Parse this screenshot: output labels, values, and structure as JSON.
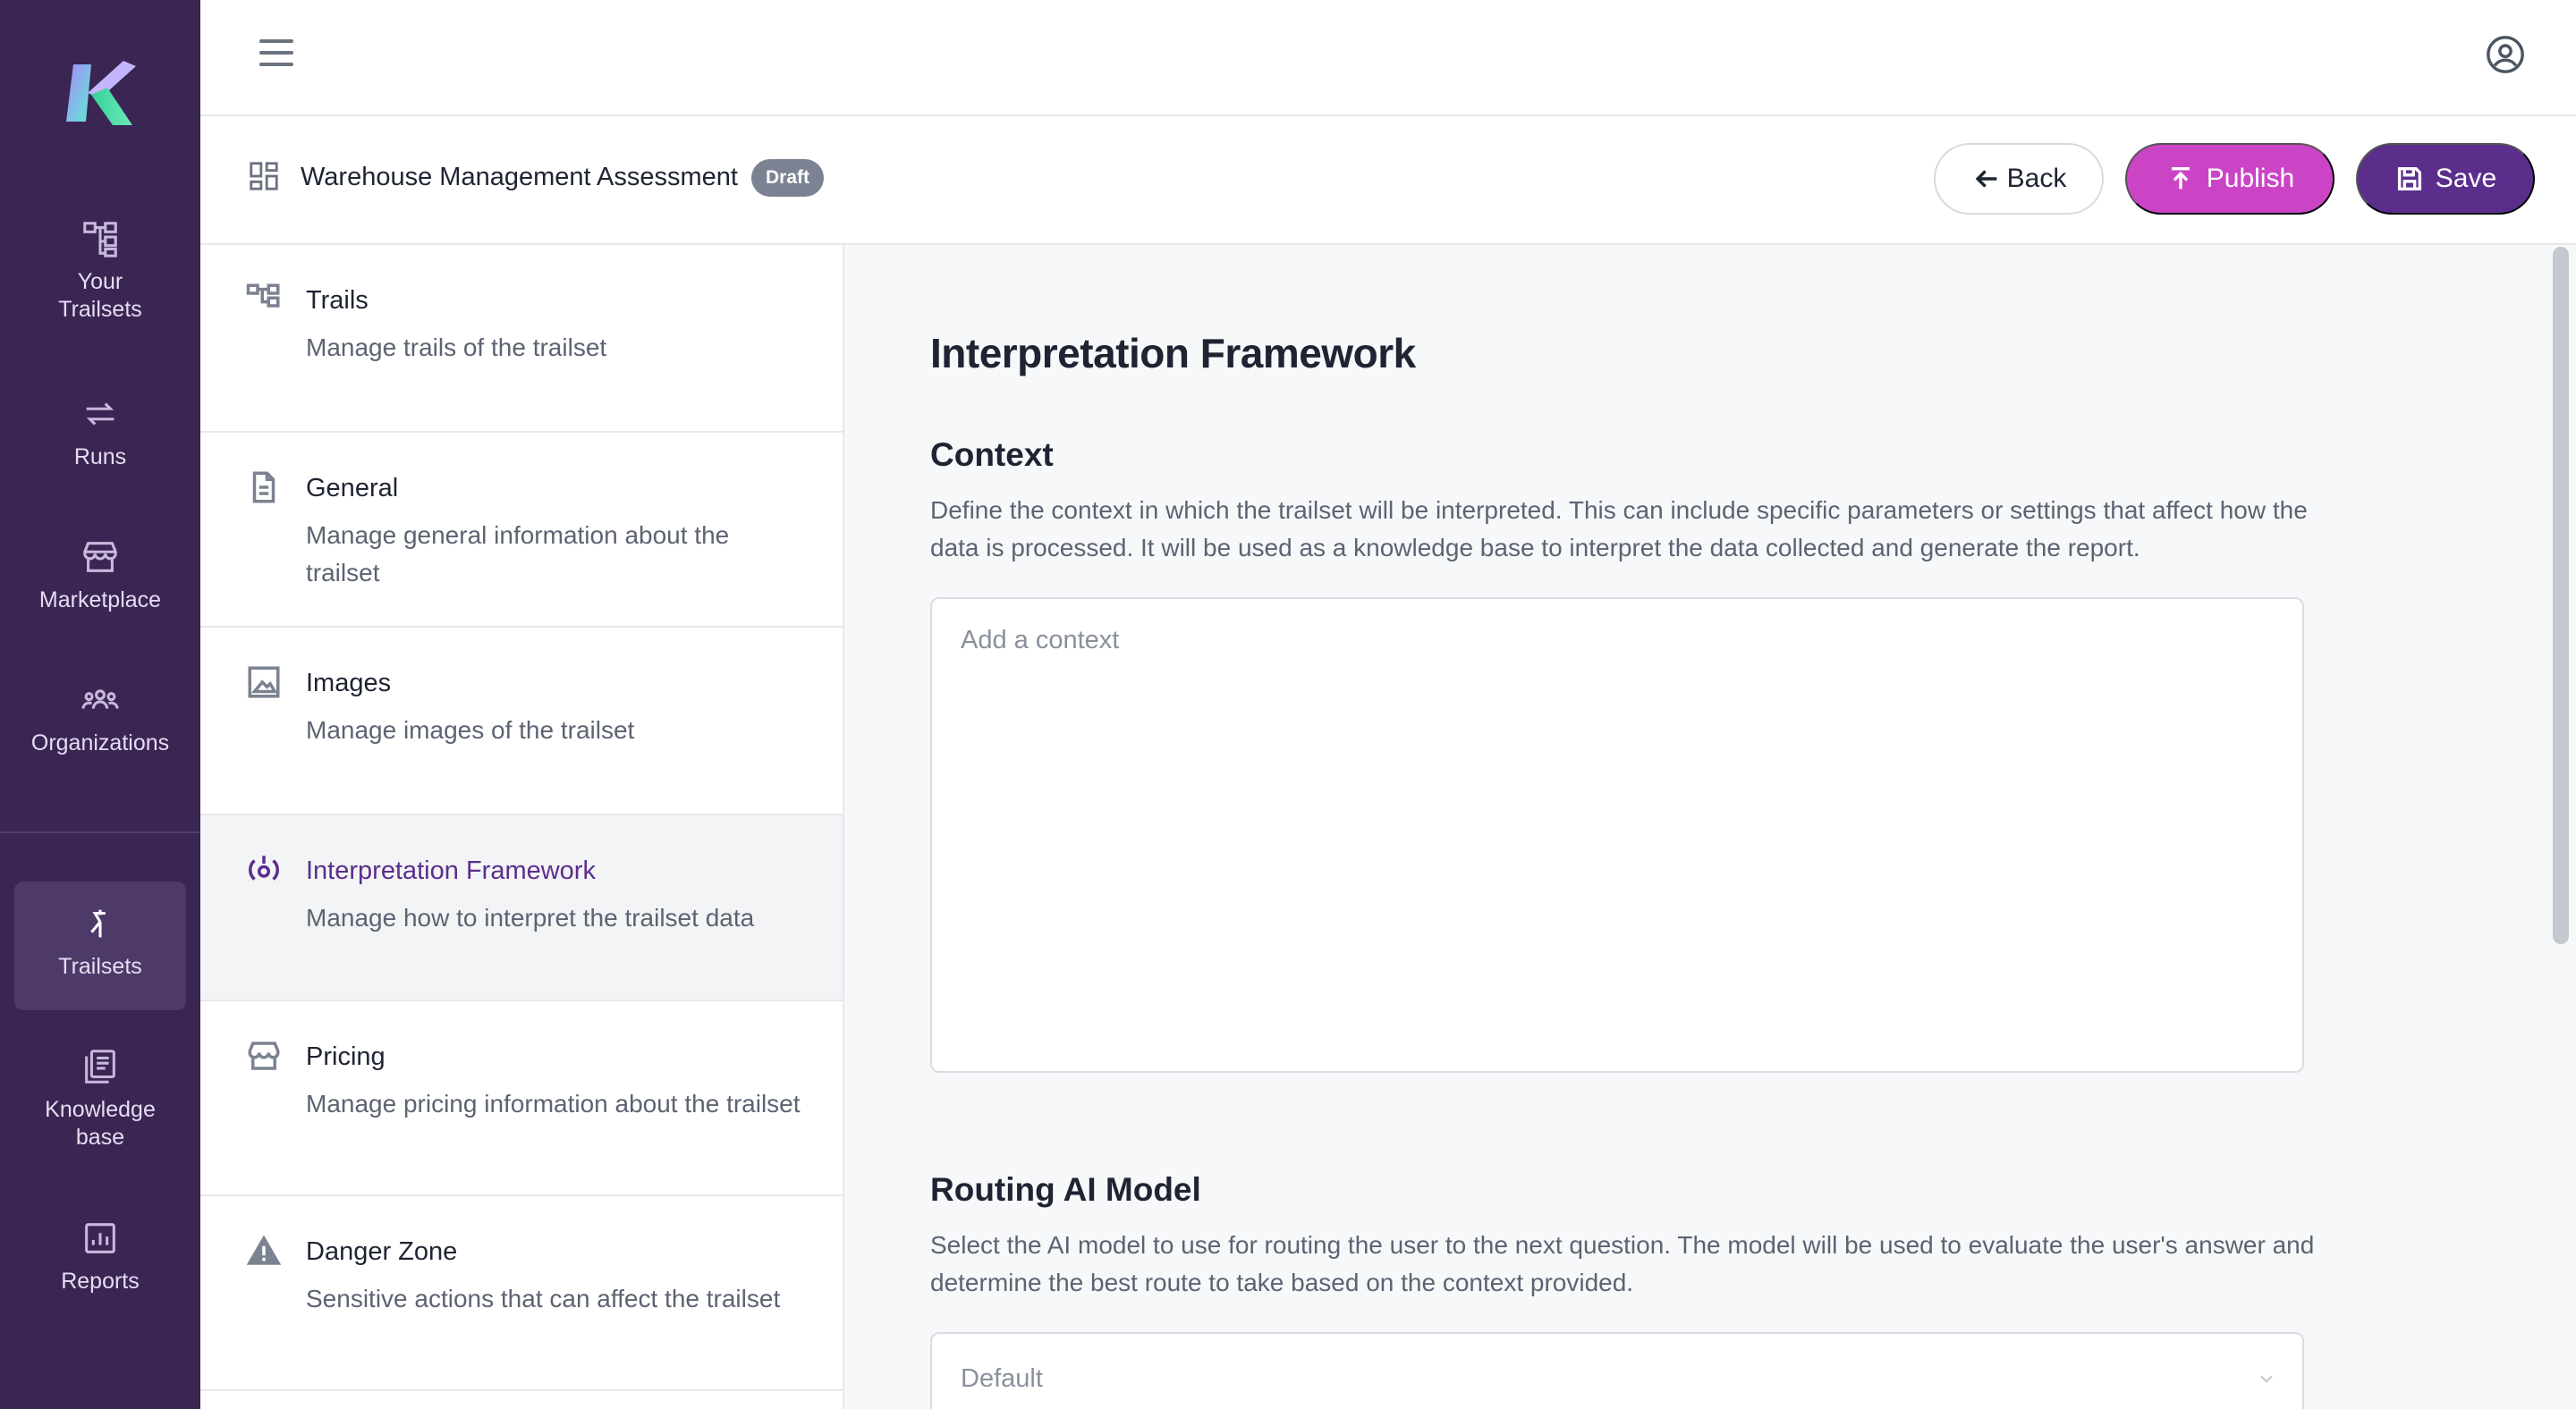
{
  "app": {
    "brand_colors": {
      "rail": "#3a2553",
      "accent": "#5b2e8c",
      "publish": "#cc44c6"
    },
    "logo_icon": "k-logo-icon"
  },
  "rail": {
    "items": [
      {
        "label": "Your\nTrailsets",
        "icon": "hierarchy-icon"
      },
      {
        "label": "Runs",
        "icon": "repeat-icon"
      },
      {
        "label": "Marketplace",
        "icon": "storefront-icon"
      },
      {
        "label": "Organizations",
        "icon": "people-icon"
      },
      {
        "label": "Trailsets",
        "icon": "merge-icon",
        "active": true
      },
      {
        "label": "Knowledge\nbase",
        "icon": "library-icon"
      },
      {
        "label": "Reports",
        "icon": "chart-icon"
      }
    ]
  },
  "header": {
    "menu_icon": "hamburger-icon",
    "account_icon": "account-circle-icon"
  },
  "subheader": {
    "icon": "dashboard-icon",
    "title": "Warehouse Management Assessment",
    "status": "Draft",
    "back_label": "Back",
    "publish_label": "Publish",
    "save_label": "Save"
  },
  "sections": [
    {
      "title": "Trails",
      "desc": "Manage trails of the trailset",
      "icon": "hierarchy-icon"
    },
    {
      "title": "General",
      "desc": "Manage general information about the trailset",
      "icon": "document-icon"
    },
    {
      "title": "Images",
      "desc": "Manage images of the trailset",
      "icon": "image-icon"
    },
    {
      "title": "Interpretation Framework",
      "desc": "Manage how to interpret the trailset data",
      "icon": "interpretation-icon",
      "active": true
    },
    {
      "title": "Pricing",
      "desc": "Manage pricing information about the trailset",
      "icon": "storefront-icon"
    },
    {
      "title": "Danger Zone",
      "desc": "Sensitive actions that can affect the trailset",
      "icon": "warning-icon"
    }
  ],
  "main": {
    "title": "Interpretation Framework",
    "context": {
      "heading": "Context",
      "description": "Define the context in which the trailset will be interpreted. This can include specific parameters or settings that affect how the data is processed. It will be used as a knowledge base to interpret the data collected and generate the report.",
      "placeholder": "Add a context",
      "value": ""
    },
    "routing": {
      "heading": "Routing AI Model",
      "description": "Select the AI model to use for routing the user to the next question. The model will be used to evaluate the user's answer and determine the best route to take based on the context provided.",
      "selected": "Default"
    }
  }
}
